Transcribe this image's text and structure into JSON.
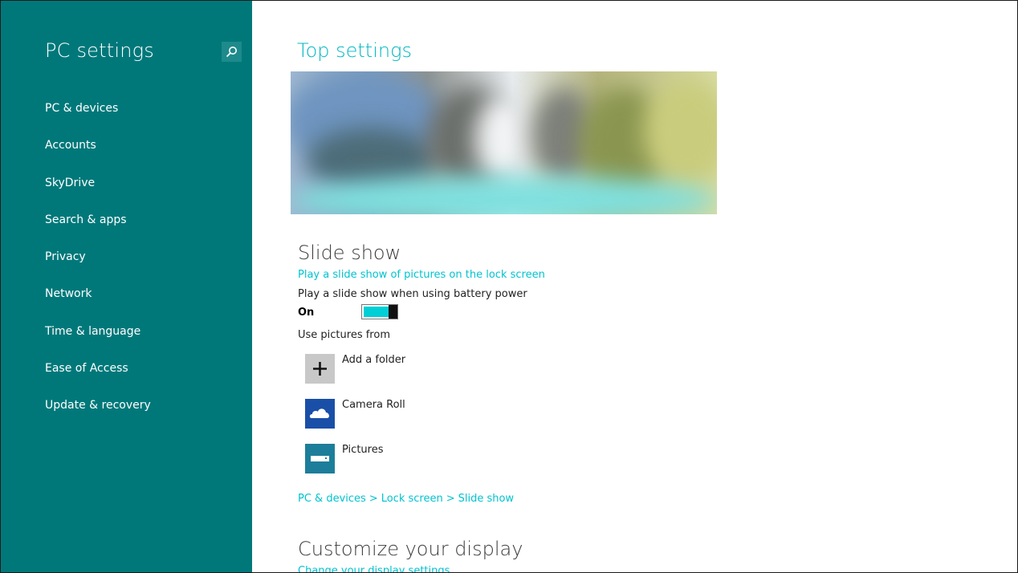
{
  "sidebar": {
    "title": "PC settings",
    "search_icon": "search-icon",
    "items": [
      {
        "label": "PC & devices"
      },
      {
        "label": "Accounts"
      },
      {
        "label": "SkyDrive"
      },
      {
        "label": "Search & apps"
      },
      {
        "label": "Privacy"
      },
      {
        "label": "Network"
      },
      {
        "label": "Time & language"
      },
      {
        "label": "Ease of Access"
      },
      {
        "label": "Update & recovery"
      }
    ]
  },
  "main": {
    "top_title": "Top settings",
    "slideshow": {
      "title": "Slide show",
      "link": "Play a slide show of pictures on the lock screen",
      "battery_label": "Play a slide show when using battery power",
      "toggle_state": "On",
      "toggle_on": true,
      "use_pictures_label": "Use pictures from",
      "sources": [
        {
          "label": "Add a folder",
          "icon": "plus-icon"
        },
        {
          "label": "Camera Roll",
          "icon": "skydrive-cloud-icon"
        },
        {
          "label": "Pictures",
          "icon": "pictures-library-icon"
        }
      ]
    },
    "breadcrumb": [
      "PC & devices",
      "Lock screen",
      "Slide show"
    ],
    "breadcrumb_separator": ">",
    "display": {
      "title": "Customize your display",
      "link": "Change your display settings"
    }
  },
  "colors": {
    "sidebar_bg": "#00787a",
    "accent": "#00c3d0",
    "toggle_fill": "#00cfd6"
  }
}
